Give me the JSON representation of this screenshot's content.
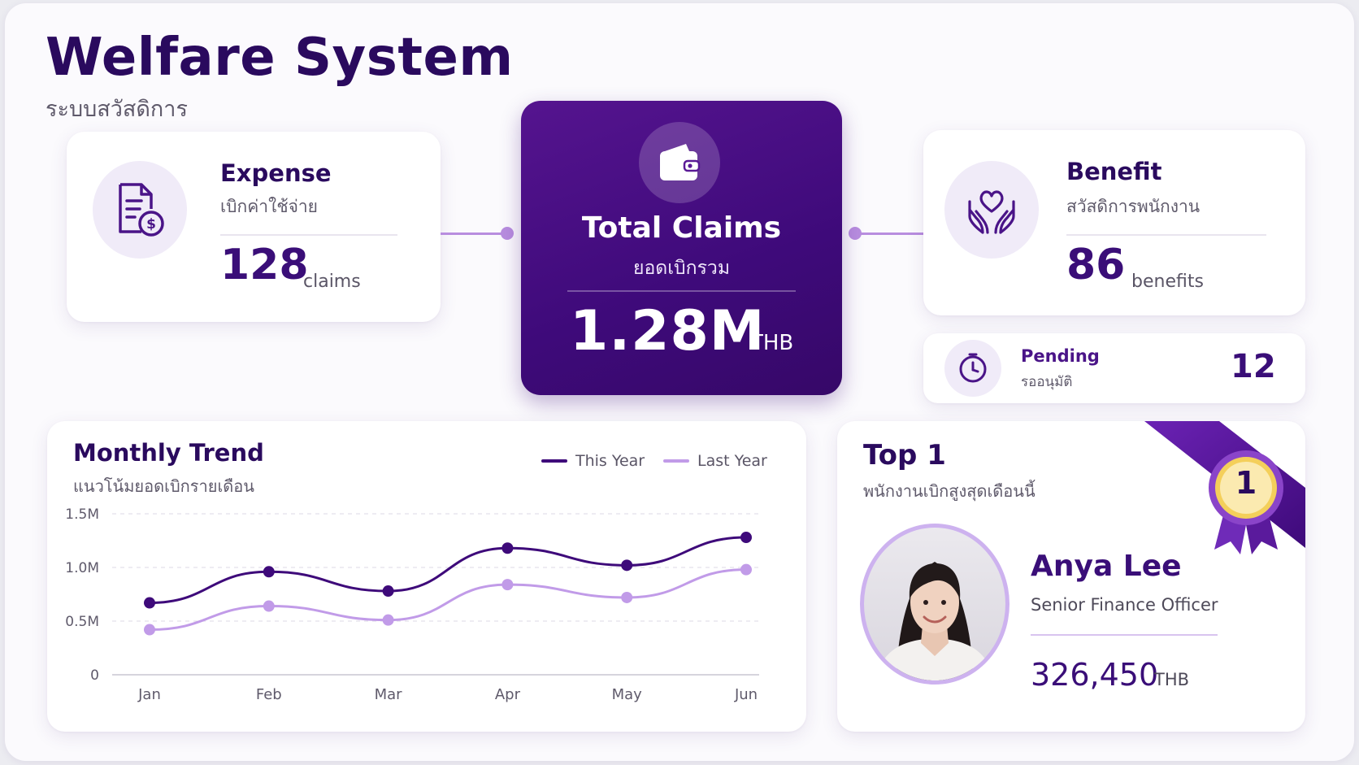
{
  "header": {
    "title": "Welfare System",
    "subtitle": "ระบบสวัสดิการ"
  },
  "expense": {
    "title": "Expense",
    "subtitle": "เบิกค่าใช้จ่าย",
    "value": "128",
    "unit": "claims",
    "icon": "document-dollar-icon"
  },
  "total": {
    "title": "Total Claims",
    "subtitle": "ยอดเบิกรวม",
    "value": "1.28M",
    "unit": "THB",
    "icon": "wallet-icon"
  },
  "benefit": {
    "title": "Benefit",
    "subtitle": "สวัสดิการพนักงาน",
    "value": "86",
    "unit": "benefits",
    "icon": "hands-heart-icon"
  },
  "pending": {
    "title": "Pending",
    "subtitle": "รออนุมัติ",
    "value": "12",
    "icon": "clock-icon"
  },
  "trend": {
    "title": "Monthly Trend",
    "subtitle": "แนวโน้มยอดเบิกรายเดือน",
    "legend_this": "This Year",
    "legend_last": "Last Year"
  },
  "top": {
    "title": "Top 1",
    "subtitle": "พนักงานเบิกสูงสุดเดือนนี้",
    "rank": "1",
    "name": "Anya Lee",
    "role": "Senior Finance Officer",
    "amount": "326,450",
    "unit": "THB"
  },
  "colors": {
    "primary": "#3e0a7a",
    "accent": "#b88ddf",
    "line_this": "#3e0a7a",
    "line_last": "#c19be8",
    "medal": "#f2c94c"
  },
  "chart_data": {
    "type": "line",
    "categories": [
      "Jan",
      "Feb",
      "Mar",
      "Apr",
      "May",
      "Jun"
    ],
    "series": [
      {
        "name": "This Year",
        "values": [
          0.67,
          0.96,
          0.78,
          1.18,
          1.02,
          1.28
        ]
      },
      {
        "name": "Last Year",
        "values": [
          0.42,
          0.64,
          0.51,
          0.84,
          0.72,
          0.98
        ]
      }
    ],
    "yticks": [
      "0",
      "0.5M",
      "1.0M",
      "1.5M"
    ],
    "ylim": [
      0,
      1.5
    ],
    "grid": true,
    "legend": "top-right"
  }
}
